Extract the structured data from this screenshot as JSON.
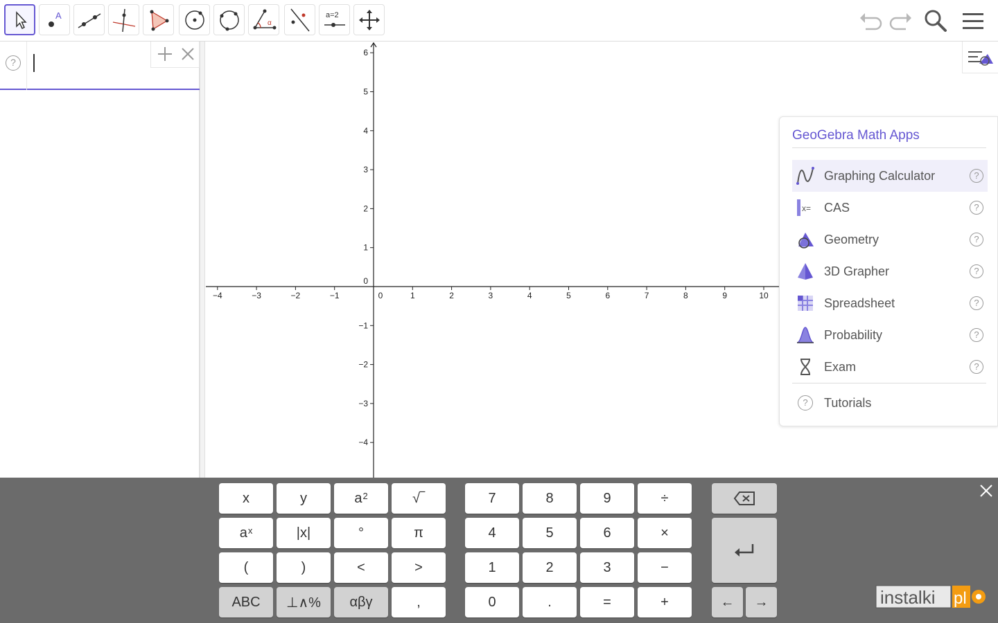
{
  "toolbar": {
    "tools": [
      {
        "name": "move-tool",
        "active": true
      },
      {
        "name": "point-tool",
        "active": false
      },
      {
        "name": "line-tool",
        "active": false
      },
      {
        "name": "perpendicular-line-tool",
        "active": false
      },
      {
        "name": "polygon-tool",
        "active": false
      },
      {
        "name": "circle-center-point-tool",
        "active": false
      },
      {
        "name": "circle-three-points-tool",
        "active": false
      },
      {
        "name": "angle-tool",
        "active": false
      },
      {
        "name": "reflect-line-tool",
        "active": false
      },
      {
        "name": "slider-tool",
        "active": false
      },
      {
        "name": "move-graphics-view-tool",
        "active": false
      }
    ],
    "slider_label": "a=2",
    "right_icons": [
      "undo-icon",
      "redo-icon",
      "search-icon",
      "menu-icon"
    ]
  },
  "algebra": {
    "help_icon_glyph": "?",
    "input_value": "",
    "input_placeholder": "",
    "add_icon_glyph": "+",
    "close_icon_glyph": "×"
  },
  "graph": {
    "x_ticks": [
      "−4",
      "−3",
      "−2",
      "−1",
      "0",
      "1",
      "2",
      "3",
      "4",
      "5",
      "6",
      "7",
      "8",
      "9",
      "10"
    ],
    "y_ticks_positive": [
      "1",
      "2",
      "3",
      "4",
      "5",
      "6"
    ],
    "y_ticks_negative": [
      "−1",
      "−2",
      "−3",
      "−4"
    ],
    "origin_label": "0"
  },
  "apps_menu": {
    "title": "GeoGebra Math Apps",
    "items": [
      {
        "label": "Graphing Calculator",
        "icon": "graphing-icon",
        "selected": true
      },
      {
        "label": "CAS",
        "icon": "cas-icon",
        "selected": false
      },
      {
        "label": "Geometry",
        "icon": "geometry-icon",
        "selected": false
      },
      {
        "label": "3D Grapher",
        "icon": "3d-icon",
        "selected": false
      },
      {
        "label": "Spreadsheet",
        "icon": "spreadsheet-icon",
        "selected": false
      },
      {
        "label": "Probability",
        "icon": "probability-icon",
        "selected": false
      },
      {
        "label": "Exam",
        "icon": "exam-icon",
        "selected": false
      }
    ],
    "tutorials_label": "Tutorials",
    "help_glyph": "?"
  },
  "keyboard": {
    "row1": {
      "k1": "x",
      "k2": "y",
      "k3": "a",
      "k3_sup": "2",
      "k4": "√‾",
      "k5": "7",
      "k6": "8",
      "k7": "9",
      "k8": "÷"
    },
    "row2": {
      "k1": "a",
      "k1_sup": "x",
      "k2": "|x|",
      "k3": "°",
      "k4": "π",
      "k5": "4",
      "k6": "5",
      "k7": "6",
      "k8": "×"
    },
    "row3": {
      "k1": "(",
      "k2": ")",
      "k3": "<",
      "k4": ">",
      "k5": "1",
      "k6": "2",
      "k7": "3",
      "k8": "−"
    },
    "row4": {
      "k1": "ABC",
      "k2": "⊥∧%",
      "k3": "αβγ",
      "k4": ",",
      "k5": "0",
      "k6": ".",
      "k7": "=",
      "k8": "+"
    },
    "backspace_glyph": "⌫",
    "enter_glyph": "↵",
    "left_arrow": "←",
    "right_arrow": "→",
    "close_glyph": "×"
  },
  "watermark": {
    "text": "instalki",
    "suffix": "pl"
  },
  "colors": {
    "accent": "#6557d2",
    "keyboard_bg": "#6b6b6b",
    "key_light": "#ffffff",
    "key_dark": "#d2d2d2"
  }
}
